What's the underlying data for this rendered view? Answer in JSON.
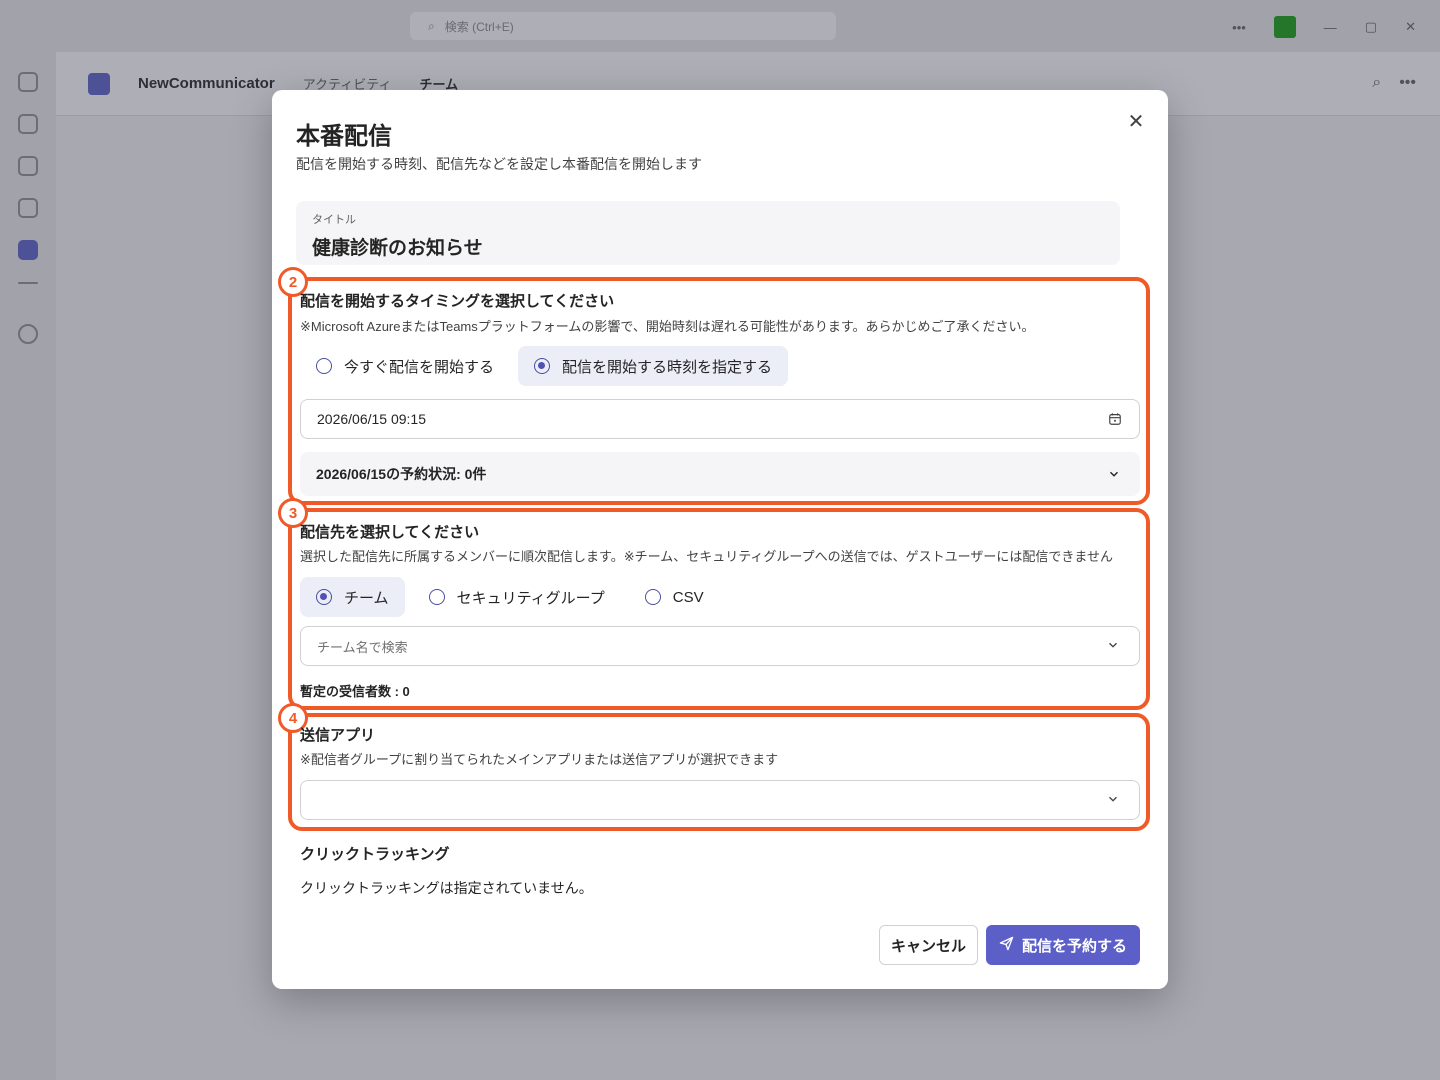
{
  "background": {
    "search_placeholder": "検索 (Ctrl+E)",
    "app_name": "NewCommunicator",
    "tabs": [
      "アクティビティ",
      "チーム"
    ]
  },
  "dialog": {
    "title": "本番配信",
    "subtitle": "配信を開始する時刻、配信先などを設定し本番配信を開始します",
    "close_icon": "close-icon",
    "title_field": {
      "label": "タイトル",
      "value": "健康診断のお知らせ"
    },
    "timing": {
      "badge": "2",
      "title": "配信を開始するタイミングを選択してください",
      "note": "※Microsoft AzureまたはTeamsプラットフォームの影響で、開始時刻は遅れる可能性があります。あらかじめご了承ください。",
      "options": [
        "今すぐ配信を開始する",
        "配信を開始する時刻を指定する"
      ],
      "selected_index": 1,
      "datetime_value": "2026/06/15 09:15",
      "reservation_status": "2026/06/15の予約状況: 0件"
    },
    "destination": {
      "badge": "3",
      "title": "配信先を選択してください",
      "note": "選択した配信先に所属するメンバーに順次配信します。※チーム、セキュリティグループへの送信では、ゲストユーザーには配信できません",
      "options": [
        "チーム",
        "セキュリティグループ",
        "CSV"
      ],
      "selected_index": 0,
      "search_placeholder": "チーム名で検索",
      "recipients": "暫定の受信者数 : 0"
    },
    "sender_app": {
      "badge": "4",
      "title": "送信アプリ",
      "note": "※配信者グループに割り当てられたメインアプリまたは送信アプリが選択できます",
      "value": ""
    },
    "click_tracking": {
      "title": "クリックトラッキング",
      "text": "クリックトラッキングは指定されていません。"
    },
    "buttons": {
      "cancel": "キャンセル",
      "submit": "配信を予約する"
    }
  },
  "colors": {
    "accent": "#5b5fc7",
    "highlight": "#f05a28"
  }
}
